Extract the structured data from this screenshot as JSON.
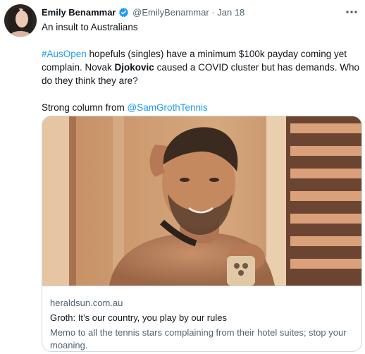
{
  "tweet": {
    "author": {
      "display_name": "Emily Benammar",
      "handle": "@EmilyBenammar",
      "date": "· Jan 18",
      "verified": true
    },
    "text": {
      "line1": "An insult to Australians",
      "hashtag": "#AusOpen",
      "p2_part1": " hopefuls (singles) have a minimum $100k payday coming yet complain. Novak ",
      "p2_bold": "Djokovic",
      "p2_part2": " caused a COVID cluster but has demands. Who do they think they are?",
      "p3_prefix": "Strong column from ",
      "mention": "@SamGrothTennis"
    },
    "card": {
      "domain": "heraldsun.com.au",
      "title": "Groth: It’s our country, you play by our rules",
      "description": "Memo to all the tennis stars complaining from their hotel suites; stop your moaning."
    }
  },
  "icons": {
    "verified": "verified-badge-icon",
    "more": "more-options-icon"
  },
  "colors": {
    "link": "#1d9bf0",
    "secondary_text": "#536471",
    "primary_text": "#0f1419",
    "border": "#cfd9de"
  }
}
